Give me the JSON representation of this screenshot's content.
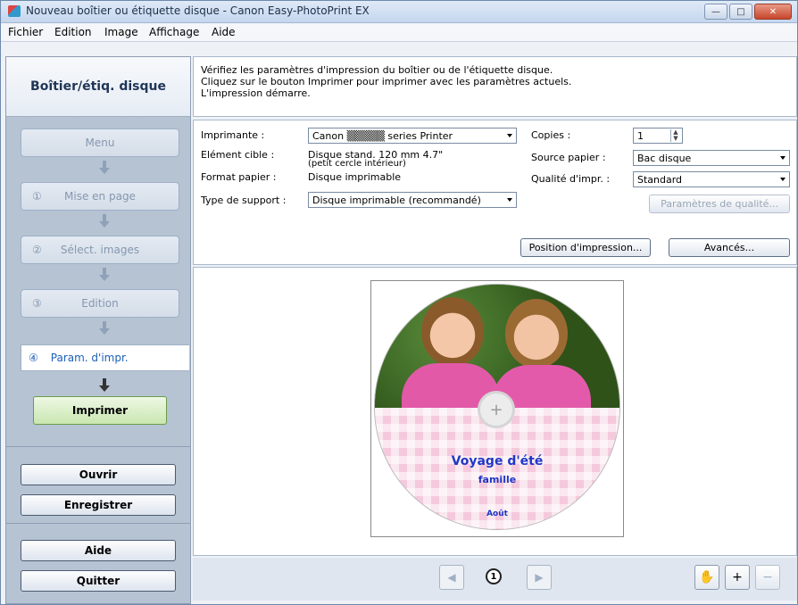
{
  "window": {
    "title": "Nouveau boîtier ou étiquette disque - Canon Easy-PhotoPrint EX",
    "minimize": "—",
    "maximize": "□",
    "close": "✕"
  },
  "menu": [
    "Fichier",
    "Edition",
    "Image",
    "Affichage",
    "Aide"
  ],
  "sidebar": {
    "header": "Boîtier/étiq. disque",
    "steps": [
      {
        "num": "",
        "label": "Menu"
      },
      {
        "num": "①",
        "label": "Mise en page"
      },
      {
        "num": "②",
        "label": "Sélect. images"
      },
      {
        "num": "③",
        "label": "Edition"
      }
    ],
    "active_step": {
      "num": "④",
      "label": "Param. d'impr."
    },
    "print_button": "Imprimer",
    "open_button": "Ouvrir",
    "save_button": "Enregistrer",
    "help_button": "Aide",
    "quit_button": "Quitter"
  },
  "info": {
    "line1": "Vérifiez les paramètres d'impression du boîtier ou de l'étiquette disque.",
    "line2": "Cliquez sur le bouton Imprimer pour imprimer avec les paramètres actuels.",
    "line3": "L'impression démarre."
  },
  "settings": {
    "printer_label": "Imprimante :",
    "printer_value": "Canon ▒▒▒▒▒ series Printer",
    "target_label": "Elément cible :",
    "target_value": "Disque stand. 120 mm 4.7\"",
    "target_value2": "(petit cercle intérieur)",
    "paper_label": "Format papier :",
    "paper_value": "Disque imprimable",
    "media_label": "Type de support :",
    "media_value": "Disque imprimable (recommandé)",
    "copies_label": "Copies :",
    "copies_value": "1",
    "source_label": "Source papier :",
    "source_value": "Bac disque",
    "quality_label": "Qualité d'impr. :",
    "quality_value": "Standard",
    "quality_settings_button": "Paramètres de qualité...",
    "print_position_button": "Position d'impression...",
    "advanced_button": "Avancés..."
  },
  "preview": {
    "title_text": "Voyage d'été",
    "subtitle_text": "famille",
    "footer_text": "Août",
    "page_number": "1"
  },
  "toolbar": {
    "prev_icon": "◀",
    "next_icon": "▶",
    "hand_icon": "✋",
    "zoom_in_icon": "+",
    "zoom_out_icon": "−"
  }
}
